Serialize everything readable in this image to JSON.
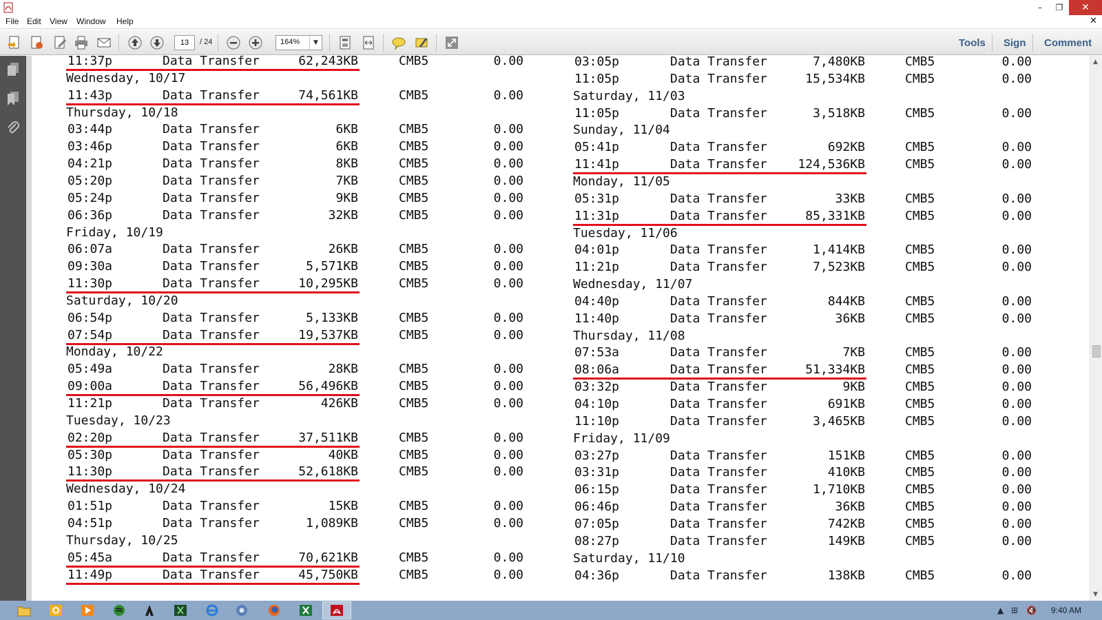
{
  "window": {
    "app_icon": "pdf-icon",
    "minimize_glyph": "–",
    "restore_glyph": "❐",
    "close_glyph": "✕"
  },
  "menu": {
    "items": [
      "File",
      "Edit",
      "View",
      "Window",
      "Help"
    ],
    "close_doc_glyph": "✕"
  },
  "toolbar": {
    "page_current": "13",
    "page_total": "/ 24",
    "zoom": "164%",
    "tools_label": "Tools",
    "sign_label": "Sign",
    "comment_label": "Comment"
  },
  "colors": {
    "underline": "#e0101c",
    "taskbar": "#8ea8c7",
    "close_button": "#c7372f",
    "right_panel_links": "#3b5f8a"
  },
  "left_column": [
    {
      "type": "row",
      "time": "11:37p",
      "desc": "Data Transfer",
      "size": "62,243KB",
      "carrier": "CMB5",
      "amount": "0.00",
      "underline": true
    },
    {
      "type": "date",
      "label": "Wednesday, 10/17"
    },
    {
      "type": "row",
      "time": "11:43p",
      "desc": "Data Transfer",
      "size": "74,561KB",
      "carrier": "CMB5",
      "amount": "0.00",
      "underline": true
    },
    {
      "type": "date",
      "label": "Thursday, 10/18"
    },
    {
      "type": "row",
      "time": "03:44p",
      "desc": "Data Transfer",
      "size": "6KB",
      "carrier": "CMB5",
      "amount": "0.00",
      "underline": false
    },
    {
      "type": "row",
      "time": "03:46p",
      "desc": "Data Transfer",
      "size": "6KB",
      "carrier": "CMB5",
      "amount": "0.00",
      "underline": false
    },
    {
      "type": "row",
      "time": "04:21p",
      "desc": "Data Transfer",
      "size": "8KB",
      "carrier": "CMB5",
      "amount": "0.00",
      "underline": false
    },
    {
      "type": "row",
      "time": "05:20p",
      "desc": "Data Transfer",
      "size": "7KB",
      "carrier": "CMB5",
      "amount": "0.00",
      "underline": false
    },
    {
      "type": "row",
      "time": "05:24p",
      "desc": "Data Transfer",
      "size": "9KB",
      "carrier": "CMB5",
      "amount": "0.00",
      "underline": false
    },
    {
      "type": "row",
      "time": "06:36p",
      "desc": "Data Transfer",
      "size": "32KB",
      "carrier": "CMB5",
      "amount": "0.00",
      "underline": false
    },
    {
      "type": "date",
      "label": "Friday, 10/19"
    },
    {
      "type": "row",
      "time": "06:07a",
      "desc": "Data Transfer",
      "size": "26KB",
      "carrier": "CMB5",
      "amount": "0.00",
      "underline": false
    },
    {
      "type": "row",
      "time": "09:30a",
      "desc": "Data Transfer",
      "size": "5,571KB",
      "carrier": "CMB5",
      "amount": "0.00",
      "underline": false
    },
    {
      "type": "row",
      "time": "11:30p",
      "desc": "Data Transfer",
      "size": "10,295KB",
      "carrier": "CMB5",
      "amount": "0.00",
      "underline": true
    },
    {
      "type": "date",
      "label": "Saturday, 10/20"
    },
    {
      "type": "row",
      "time": "06:54p",
      "desc": "Data Transfer",
      "size": "5,133KB",
      "carrier": "CMB5",
      "amount": "0.00",
      "underline": false
    },
    {
      "type": "row",
      "time": "07:54p",
      "desc": "Data Transfer",
      "size": "19,537KB",
      "carrier": "CMB5",
      "amount": "0.00",
      "underline": true
    },
    {
      "type": "date",
      "label": "Monday, 10/22"
    },
    {
      "type": "row",
      "time": "05:49a",
      "desc": "Data Transfer",
      "size": "28KB",
      "carrier": "CMB5",
      "amount": "0.00",
      "underline": false
    },
    {
      "type": "row",
      "time": "09:00a",
      "desc": "Data Transfer",
      "size": "56,496KB",
      "carrier": "CMB5",
      "amount": "0.00",
      "underline": true
    },
    {
      "type": "row",
      "time": "11:21p",
      "desc": "Data Transfer",
      "size": "426KB",
      "carrier": "CMB5",
      "amount": "0.00",
      "underline": false
    },
    {
      "type": "date",
      "label": "Tuesday, 10/23"
    },
    {
      "type": "row",
      "time": "02:20p",
      "desc": "Data Transfer",
      "size": "37,511KB",
      "carrier": "CMB5",
      "amount": "0.00",
      "underline": true
    },
    {
      "type": "row",
      "time": "05:30p",
      "desc": "Data Transfer",
      "size": "40KB",
      "carrier": "CMB5",
      "amount": "0.00",
      "underline": false
    },
    {
      "type": "row",
      "time": "11:30p",
      "desc": "Data Transfer",
      "size": "52,618KB",
      "carrier": "CMB5",
      "amount": "0.00",
      "underline": true
    },
    {
      "type": "date",
      "label": "Wednesday, 10/24"
    },
    {
      "type": "row",
      "time": "01:51p",
      "desc": "Data Transfer",
      "size": "15KB",
      "carrier": "CMB5",
      "amount": "0.00",
      "underline": false
    },
    {
      "type": "row",
      "time": "04:51p",
      "desc": "Data Transfer",
      "size": "1,089KB",
      "carrier": "CMB5",
      "amount": "0.00",
      "underline": false
    },
    {
      "type": "date",
      "label": "Thursday, 10/25"
    },
    {
      "type": "row",
      "time": "05:45a",
      "desc": "Data Transfer",
      "size": "70,621KB",
      "carrier": "CMB5",
      "amount": "0.00",
      "underline": true
    },
    {
      "type": "row",
      "time": "11:49p",
      "desc": "Data Transfer",
      "size": "45,750KB",
      "carrier": "CMB5",
      "amount": "0.00",
      "underline": true
    }
  ],
  "right_column": [
    {
      "type": "row",
      "time": "03:05p",
      "desc": "Data Transfer",
      "size": "7,480KB",
      "carrier": "CMB5",
      "amount": "0.00",
      "underline": false
    },
    {
      "type": "row",
      "time": "11:05p",
      "desc": "Data Transfer",
      "size": "15,534KB",
      "carrier": "CMB5",
      "amount": "0.00",
      "underline": false
    },
    {
      "type": "date",
      "label": "Saturday, 11/03"
    },
    {
      "type": "row",
      "time": "11:05p",
      "desc": "Data Transfer",
      "size": "3,518KB",
      "carrier": "CMB5",
      "amount": "0.00",
      "underline": false
    },
    {
      "type": "date",
      "label": "Sunday, 11/04"
    },
    {
      "type": "row",
      "time": "05:41p",
      "desc": "Data Transfer",
      "size": "692KB",
      "carrier": "CMB5",
      "amount": "0.00",
      "underline": false
    },
    {
      "type": "row",
      "time": "11:41p",
      "desc": "Data Transfer",
      "size": "124,536KB",
      "carrier": "CMB5",
      "amount": "0.00",
      "underline": true
    },
    {
      "type": "date",
      "label": "Monday, 11/05"
    },
    {
      "type": "row",
      "time": "05:31p",
      "desc": "Data Transfer",
      "size": "33KB",
      "carrier": "CMB5",
      "amount": "0.00",
      "underline": false
    },
    {
      "type": "row",
      "time": "11:31p",
      "desc": "Data Transfer",
      "size": "85,331KB",
      "carrier": "CMB5",
      "amount": "0.00",
      "underline": true
    },
    {
      "type": "date",
      "label": "Tuesday, 11/06"
    },
    {
      "type": "row",
      "time": "04:01p",
      "desc": "Data Transfer",
      "size": "1,414KB",
      "carrier": "CMB5",
      "amount": "0.00",
      "underline": false
    },
    {
      "type": "row",
      "time": "11:21p",
      "desc": "Data Transfer",
      "size": "7,523KB",
      "carrier": "CMB5",
      "amount": "0.00",
      "underline": false
    },
    {
      "type": "date",
      "label": "Wednesday, 11/07"
    },
    {
      "type": "row",
      "time": "04:40p",
      "desc": "Data Transfer",
      "size": "844KB",
      "carrier": "CMB5",
      "amount": "0.00",
      "underline": false
    },
    {
      "type": "row",
      "time": "11:40p",
      "desc": "Data Transfer",
      "size": "36KB",
      "carrier": "CMB5",
      "amount": "0.00",
      "underline": false
    },
    {
      "type": "date",
      "label": "Thursday, 11/08"
    },
    {
      "type": "row",
      "time": "07:53a",
      "desc": "Data Transfer",
      "size": "7KB",
      "carrier": "CMB5",
      "amount": "0.00",
      "underline": false
    },
    {
      "type": "row",
      "time": "08:06a",
      "desc": "Data Transfer",
      "size": "51,334KB",
      "carrier": "CMB5",
      "amount": "0.00",
      "underline": true
    },
    {
      "type": "row",
      "time": "03:32p",
      "desc": "Data Transfer",
      "size": "9KB",
      "carrier": "CMB5",
      "amount": "0.00",
      "underline": false
    },
    {
      "type": "row",
      "time": "04:10p",
      "desc": "Data Transfer",
      "size": "691KB",
      "carrier": "CMB5",
      "amount": "0.00",
      "underline": false
    },
    {
      "type": "row",
      "time": "11:10p",
      "desc": "Data Transfer",
      "size": "3,465KB",
      "carrier": "CMB5",
      "amount": "0.00",
      "underline": false
    },
    {
      "type": "date",
      "label": "Friday, 11/09"
    },
    {
      "type": "row",
      "time": "03:27p",
      "desc": "Data Transfer",
      "size": "151KB",
      "carrier": "CMB5",
      "amount": "0.00",
      "underline": false
    },
    {
      "type": "row",
      "time": "03:31p",
      "desc": "Data Transfer",
      "size": "410KB",
      "carrier": "CMB5",
      "amount": "0.00",
      "underline": false
    },
    {
      "type": "row",
      "time": "06:15p",
      "desc": "Data Transfer",
      "size": "1,710KB",
      "carrier": "CMB5",
      "amount": "0.00",
      "underline": false
    },
    {
      "type": "row",
      "time": "06:46p",
      "desc": "Data Transfer",
      "size": "36KB",
      "carrier": "CMB5",
      "amount": "0.00",
      "underline": false
    },
    {
      "type": "row",
      "time": "07:05p",
      "desc": "Data Transfer",
      "size": "742KB",
      "carrier": "CMB5",
      "amount": "0.00",
      "underline": false
    },
    {
      "type": "row",
      "time": "08:27p",
      "desc": "Data Transfer",
      "size": "149KB",
      "carrier": "CMB5",
      "amount": "0.00",
      "underline": false
    },
    {
      "type": "date",
      "label": "Saturday, 11/10"
    },
    {
      "type": "row",
      "time": "04:36p",
      "desc": "Data Transfer",
      "size": "138KB",
      "carrier": "CMB5",
      "amount": "0.00",
      "underline": false
    }
  ],
  "taskbar": {
    "apps": [
      "file-explorer-icon",
      "outlook-icon",
      "media-player-icon",
      "spotify-icon",
      "app-icon",
      "excel-like-icon",
      "internet-explorer-icon",
      "chrome-like-icon",
      "firefox-icon",
      "excel-icon",
      "acrobat-icon"
    ],
    "clock": "9:40 AM"
  }
}
